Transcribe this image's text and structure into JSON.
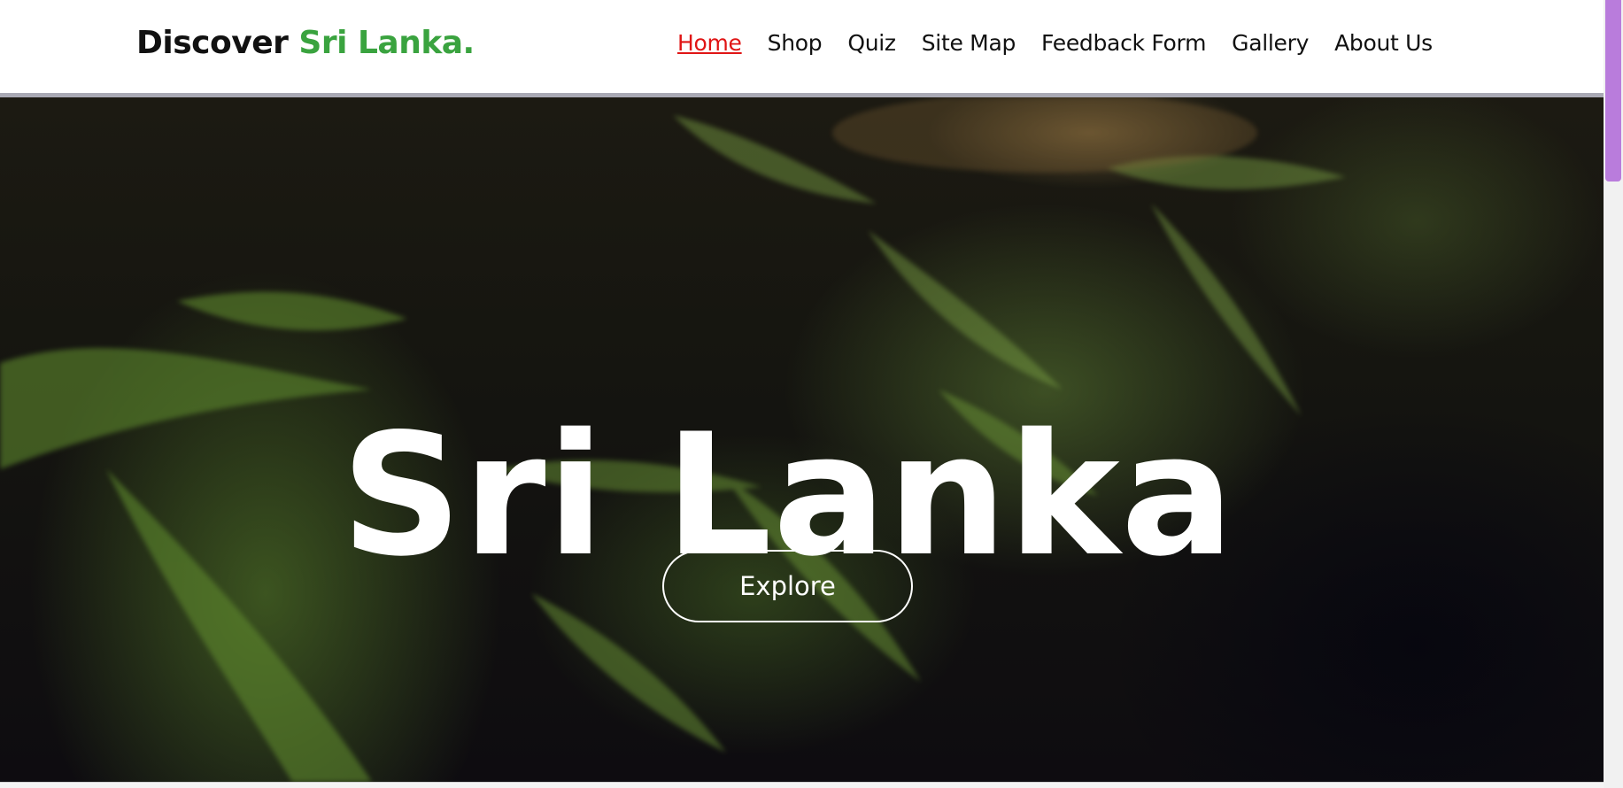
{
  "brand": {
    "prefix": "Discover",
    "highlight": "Sri Lanka."
  },
  "nav": {
    "items": [
      {
        "label": "Home",
        "active": true
      },
      {
        "label": "Shop"
      },
      {
        "label": "Quiz"
      },
      {
        "label": "Site Map"
      },
      {
        "label": "Feedback Form"
      },
      {
        "label": "Gallery"
      },
      {
        "label": "About Us"
      }
    ]
  },
  "hero": {
    "title": "Sri Lanka",
    "button_label": "Explore"
  },
  "colors": {
    "brand_accent": "#3aa33f",
    "active_link": "#e01515",
    "scroll_thumb": "#b97cdc"
  }
}
